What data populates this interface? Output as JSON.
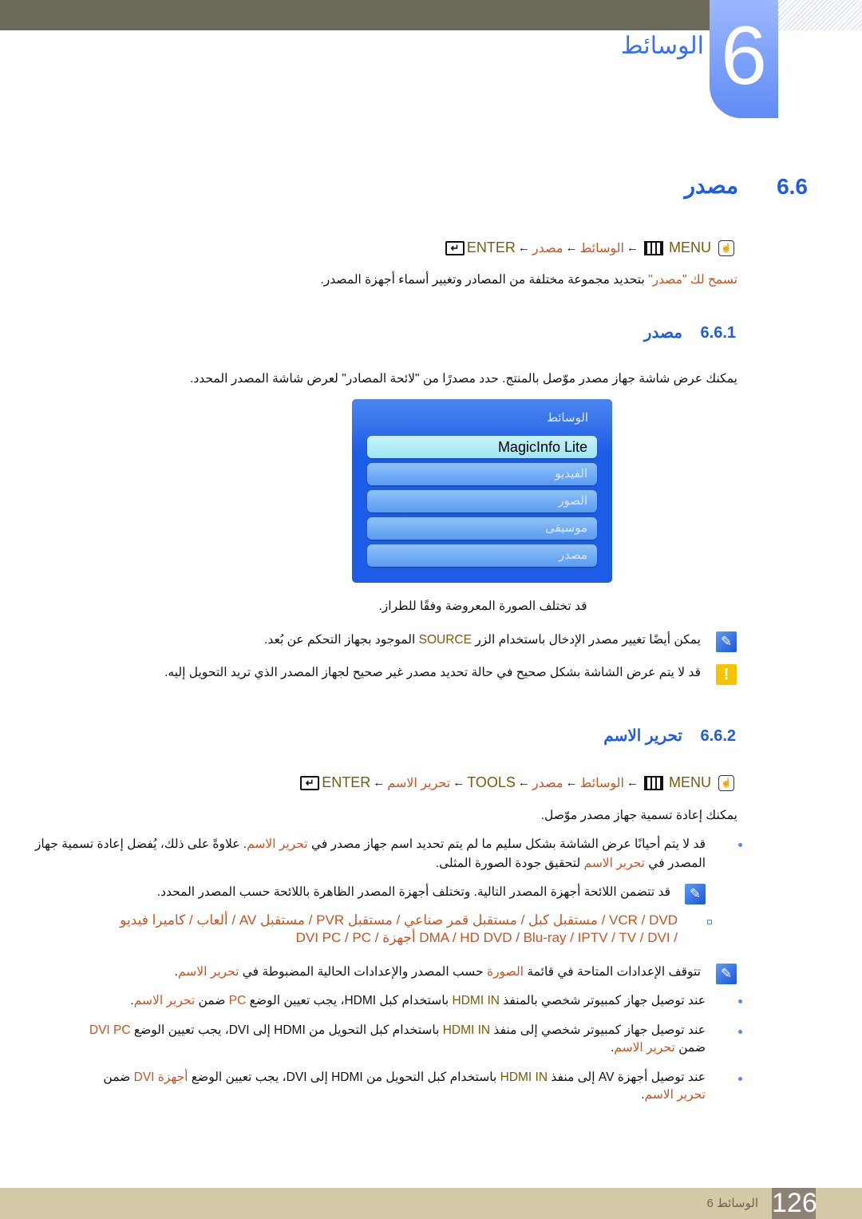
{
  "chapter": {
    "number": "6",
    "title": "الوسائط"
  },
  "section": {
    "number": "6.6",
    "title": "مصدر"
  },
  "path1": {
    "menu": "MENU",
    "media": "الوسائط",
    "source": "مصدر",
    "enter": "ENTER",
    "arrow": "←"
  },
  "intro": [
    {
      "t": "تسمح لك \"مصدر\"",
      "c": "o"
    },
    {
      "t": " بتحديد مجموعة مختلفة من المصادر وتغيير أسماء أجهزة المصدر.",
      "c": ""
    }
  ],
  "sub1": {
    "number": "6.6.1",
    "title": "مصدر"
  },
  "sub1_para": [
    {
      "t": "يمكنك عرض شاشة جهاز مصدر موّصل بالمنتج. حدد مصدرًا من \"لائحة المصادر\" لعرض شاشة المصدر المحدد.",
      "c": ""
    }
  ],
  "screen": {
    "title": "الوسائط",
    "items": [
      {
        "label": "MagicInfo Lite",
        "selected": true
      },
      {
        "label": "الفيديو"
      },
      {
        "label": "الصور"
      },
      {
        "label": "موسيقى"
      },
      {
        "label": "مصدر"
      }
    ]
  },
  "caption": "قد تختلف الصورة المعروضة وفقًا للطراز.",
  "note1": [
    {
      "t": "يمكن أيضًا تغيير مصدر الإدخال باستخدام الزر ",
      "c": ""
    },
    {
      "t": "SOURCE",
      "c": "g"
    },
    {
      "t": " الموجود بجهاز التحكم عن بُعد.",
      "c": ""
    }
  ],
  "warn1": [
    {
      "t": "قد لا يتم عرض الشاشة بشكل صحيح في حالة تحديد مصدر غير صحيح لجهاز المصدر الذي تريد التحويل إليه.",
      "c": ""
    }
  ],
  "sub2": {
    "number": "6.6.2",
    "title": "تحرير الاسم"
  },
  "path2": {
    "menu": "MENU",
    "media": "الوسائط",
    "source": "مصدر",
    "tools": "TOOLS",
    "edit": "تحرير الاسم",
    "enter": "ENTER",
    "arrow": "←"
  },
  "sub2_para": [
    {
      "t": "يمكنك إعادة تسمية جهاز مصدر موّصل.",
      "c": ""
    }
  ],
  "b1_l1": [
    {
      "t": "قد لا يتم أحيانًا عرض الشاشة بشكل سليم ما لم يتم تحديد اسم جهاز مصدر في ",
      "c": ""
    },
    {
      "t": "تحرير الاسم",
      "c": "o"
    },
    {
      "t": ". علاوةً على ذلك، يُفضل إعادة تسمية جهاز",
      "c": ""
    }
  ],
  "b1_l2": [
    {
      "t": "المصدر في ",
      "c": ""
    },
    {
      "t": "تحرير الاسم",
      "c": "o"
    },
    {
      "t": " لتحقيق جودة الصورة المثلى.",
      "c": ""
    }
  ],
  "note2": [
    {
      "t": "قد تتضمن اللائحة أجهزة المصدر التالية. وتختلف أجهزة المصدر الظاهرة باللائحة حسب المصدر المحدد.",
      "c": ""
    }
  ],
  "devices_l1": [
    {
      "t": "VCR / DVD / مستقبل كبل / مستقبل قمر صناعي / مستقبل PVR / مستقبل AV / ألعاب / كاميرا فيديو",
      "c": "o"
    }
  ],
  "devices_l2": [
    {
      "t": "/ DMA / HD DVD / Blu-ray / IPTV / TV / DVI أجهزة / DVI PC / PC",
      "c": "o"
    }
  ],
  "note3": [
    {
      "t": "تتوقف الإعدادات المتاحة في قائمة ",
      "c": ""
    },
    {
      "t": "الصورة",
      "c": "o"
    },
    {
      "t": " حسب المصدر والإعدادات الحالية المضبوطة في ",
      "c": ""
    },
    {
      "t": "تحرير الاسم",
      "c": "o"
    },
    {
      "t": ".",
      "c": ""
    }
  ],
  "b2": [
    {
      "t": "عند توصيل جهاز كمبيوتر شخصي بالمنفذ ",
      "c": ""
    },
    {
      "t": "HDMI IN",
      "c": "g"
    },
    {
      "t": " باستخدام كبل HDMI، يجب تعيين الوضع ",
      "c": ""
    },
    {
      "t": "PC",
      "c": "o"
    },
    {
      "t": " ضمن ",
      "c": ""
    },
    {
      "t": "تحرير الاسم",
      "c": "o"
    },
    {
      "t": ".",
      "c": ""
    }
  ],
  "b3_l1": [
    {
      "t": "عند توصيل جهاز كمبيوتر شخصي إلى منفذ ",
      "c": ""
    },
    {
      "t": "HDMI IN",
      "c": "g"
    },
    {
      "t": " باستخدام كبل التحويل من HDMI إلى DVI، يجب تعيين الوضع ",
      "c": ""
    },
    {
      "t": "DVI PC",
      "c": "o"
    }
  ],
  "b3_l2": [
    {
      "t": "ضمن ",
      "c": ""
    },
    {
      "t": "تحرير الاسم",
      "c": "o"
    },
    {
      "t": ".",
      "c": ""
    }
  ],
  "b4_l1": [
    {
      "t": "عند توصيل أجهزة AV إلى منفذ ",
      "c": ""
    },
    {
      "t": "HDMI IN",
      "c": "g"
    },
    {
      "t": " باستخدام كبل التحويل من HDMI إلى DVI، يجب تعيين الوضع ",
      "c": ""
    },
    {
      "t": "أجهزة DVI",
      "c": "o"
    },
    {
      "t": " ضمن",
      "c": ""
    }
  ],
  "b4_l2": [
    {
      "t": "تحرير الاسم",
      "c": "o"
    },
    {
      "t": ".",
      "c": ""
    }
  ],
  "footer": {
    "label": "الوسائط 6",
    "page": "126"
  },
  "colors": {
    "heading": "#1e5ce8",
    "menu_item": "#d0501e",
    "key": "#7a5a08",
    "footer": "#d4c9a7"
  }
}
